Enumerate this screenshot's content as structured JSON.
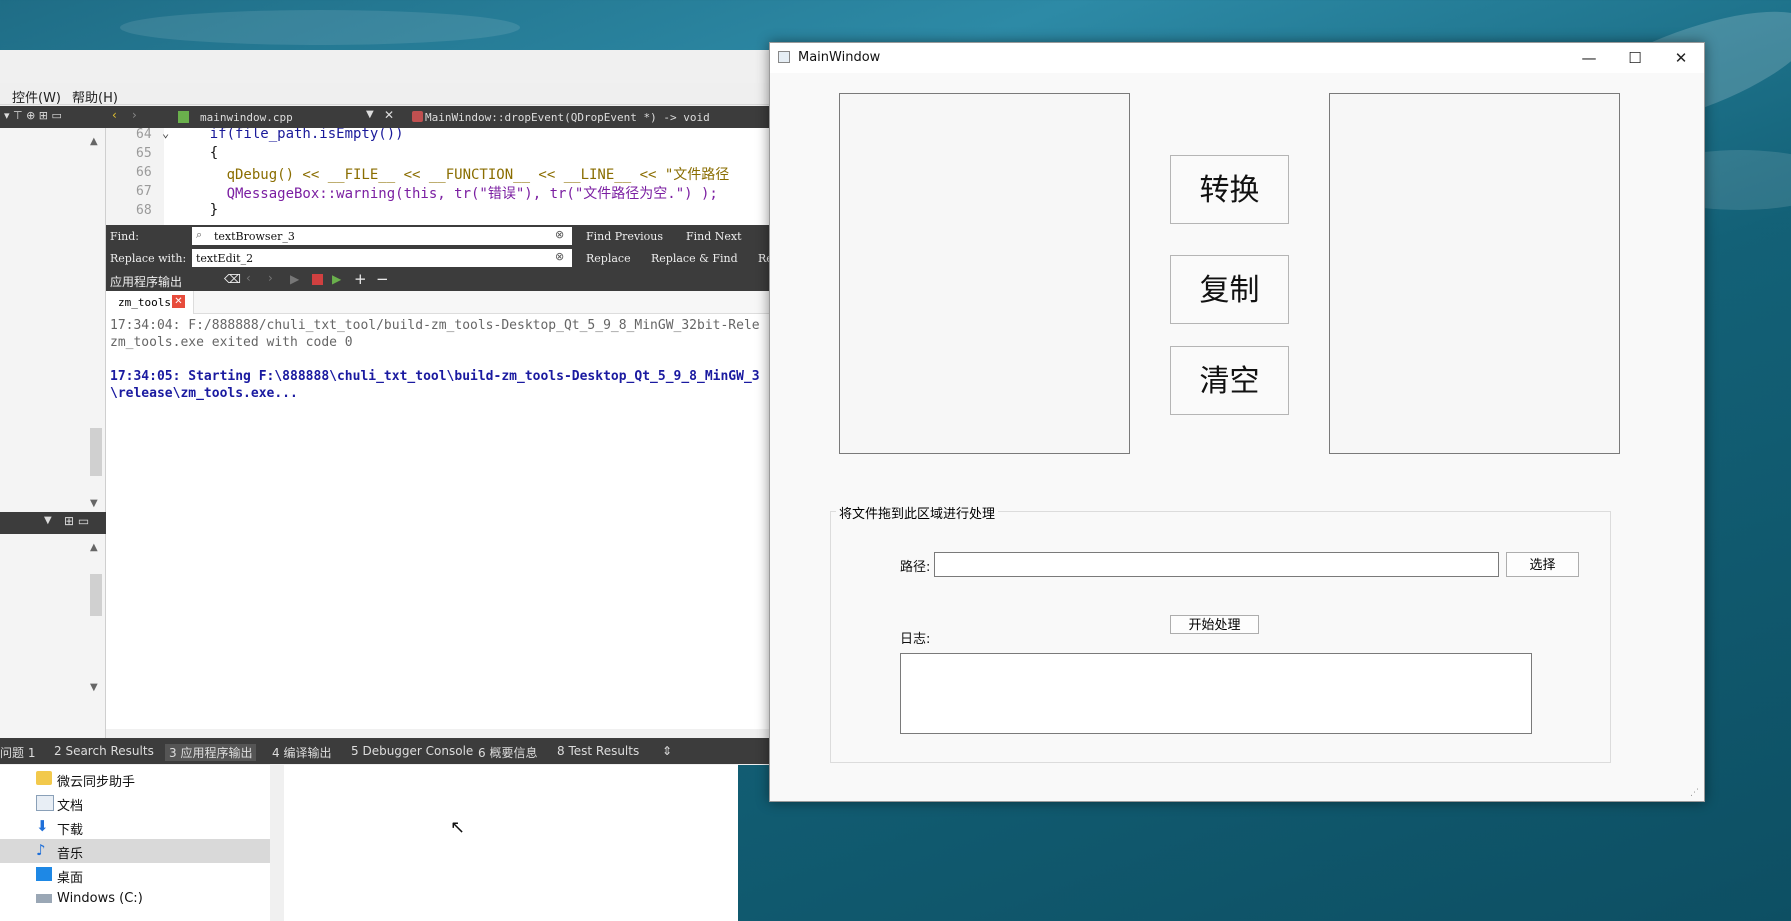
{
  "creator": {
    "menu": [
      "控件(W)",
      "帮助(H)"
    ],
    "file_tab": "mainwindow.cpp",
    "symbol": "MainWindow::dropEvent(QDropEvent *) -> void",
    "line_numbers": [
      "64",
      "65",
      "66",
      "67",
      "68"
    ],
    "code_lines": [
      "    if(file_path.isEmpty())",
      "    {",
      "      qDebug() << __FILE__ << __FUNCTION__ << __LINE__ << \"文件路径",
      "      QMessageBox::warning(this, tr(\"错误\"), tr(\"文件路径为空.\") );",
      "    }"
    ],
    "find_label": "Find:",
    "find_value": "textBrowser_3",
    "replace_label": "Replace with:",
    "replace_value": "textEdit_2",
    "find_previous": "Find Previous",
    "find_next": "Find Next",
    "replace": "Replace",
    "replace_find": "Replace & Find",
    "replace_all_partial": "Re",
    "output_title": "应用程序输出",
    "output_tab": "zm_tools",
    "output_lines": [
      "17:34:04: F:/888888/chuli_txt_tool/build-zm_tools-Desktop_Qt_5_9_8_MinGW_32bit-Rele",
      "zm_tools.exe exited with code 0",
      "",
      "17:34:05: Starting F:\\888888\\chuli_txt_tool\\build-zm_tools-Desktop_Qt_5_9_8_MinGW_3",
      "\\release\\zm_tools.exe..."
    ],
    "bottom_tabs": [
      "问题 1",
      "2 Search Results",
      "3 应用程序输出",
      "4 编译输出",
      "5 Debugger Console",
      "6 概要信息",
      "8 Test Results"
    ]
  },
  "explorer": {
    "items": [
      "微云同步助手",
      "文档",
      "下载",
      "音乐",
      "桌面",
      "Windows (C:)"
    ]
  },
  "mainwindow": {
    "title": "MainWindow",
    "btn_convert": "转换",
    "btn_copy": "复制",
    "btn_clear": "清空",
    "group_title": "将文件拖到此区域进行处理",
    "path_label": "路径:",
    "path_value": "",
    "choose": "选择",
    "start": "开始处理",
    "log_label": "日志:",
    "log_value": ""
  }
}
